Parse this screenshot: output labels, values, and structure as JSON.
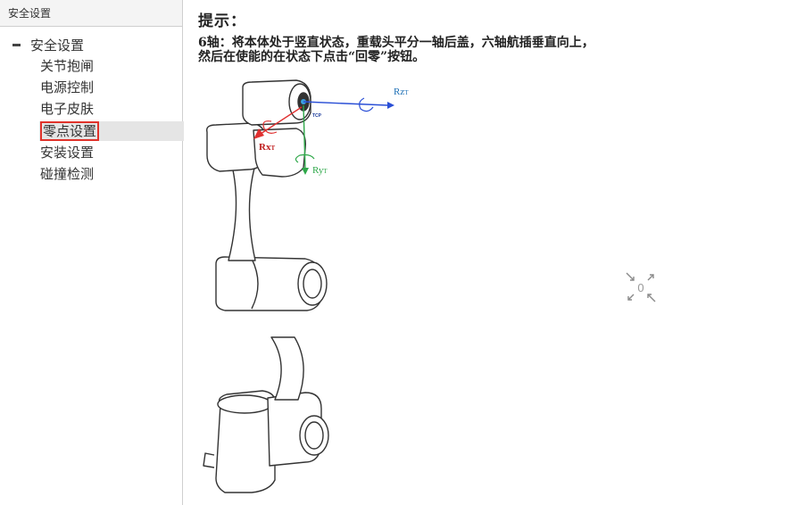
{
  "sidebar": {
    "header": "安全设置",
    "root_label": "安全设置",
    "items": [
      {
        "label": "关节抱闸"
      },
      {
        "label": "电源控制"
      },
      {
        "label": "电子皮肤"
      },
      {
        "label": "零点设置",
        "selected": true
      },
      {
        "label": "安装设置"
      },
      {
        "label": "碰撞检测"
      }
    ]
  },
  "main": {
    "hint_title": "提示：",
    "hint_line1": "6轴：将本体处于竖直状态，重载头平分一轴后盖，六轴航插垂直向上，",
    "hint_line2": "然后在使能的在状态下点击“回零”按钮。",
    "diagram": {
      "rz_label": "Rz",
      "rz_sub": "T",
      "rx_label": "Rx",
      "rx_sub": "T",
      "ry_label": "Ry",
      "ry_sub": "T",
      "tcp_label": "TCP",
      "zero_label": "0"
    }
  },
  "colors": {
    "selection_border": "#e0322a",
    "rz_axis": "#2a4fd6",
    "rx_axis": "#e03030",
    "ry_axis": "#2fa84a"
  }
}
